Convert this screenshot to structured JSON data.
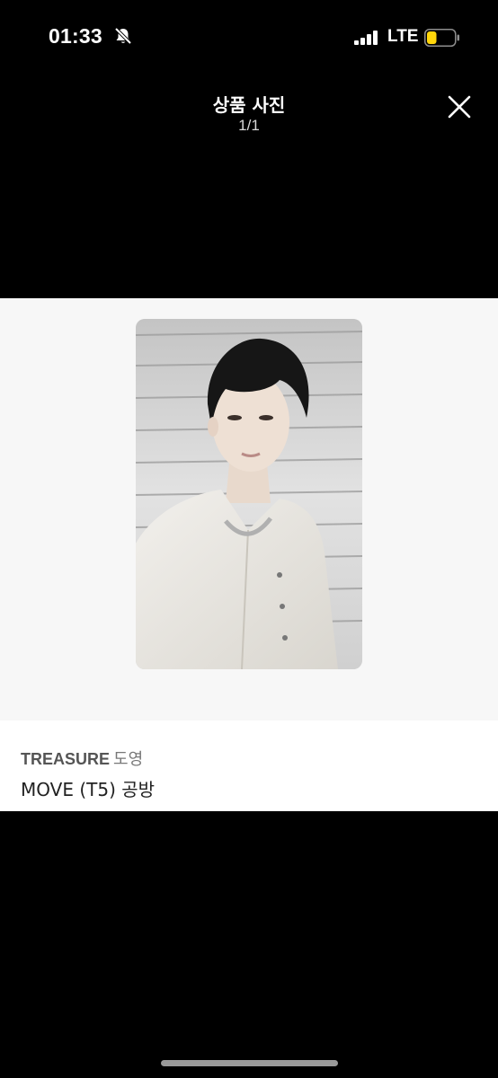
{
  "status_bar": {
    "time": "01:33",
    "network": "LTE",
    "mute_icon": "bell-slash-icon",
    "signal_icon": "cellular-signal-icon",
    "battery_icon": "battery-icon",
    "battery_color": "#ffd60a",
    "battery_level": 0.35
  },
  "header": {
    "title": "상품 사진",
    "counter": "1/1",
    "close_icon": "close-icon"
  },
  "photo": {
    "subject": "photocard-image"
  },
  "product": {
    "brand": "TREASURE",
    "member": "도영",
    "name": "MOVE (T5) 공방"
  }
}
